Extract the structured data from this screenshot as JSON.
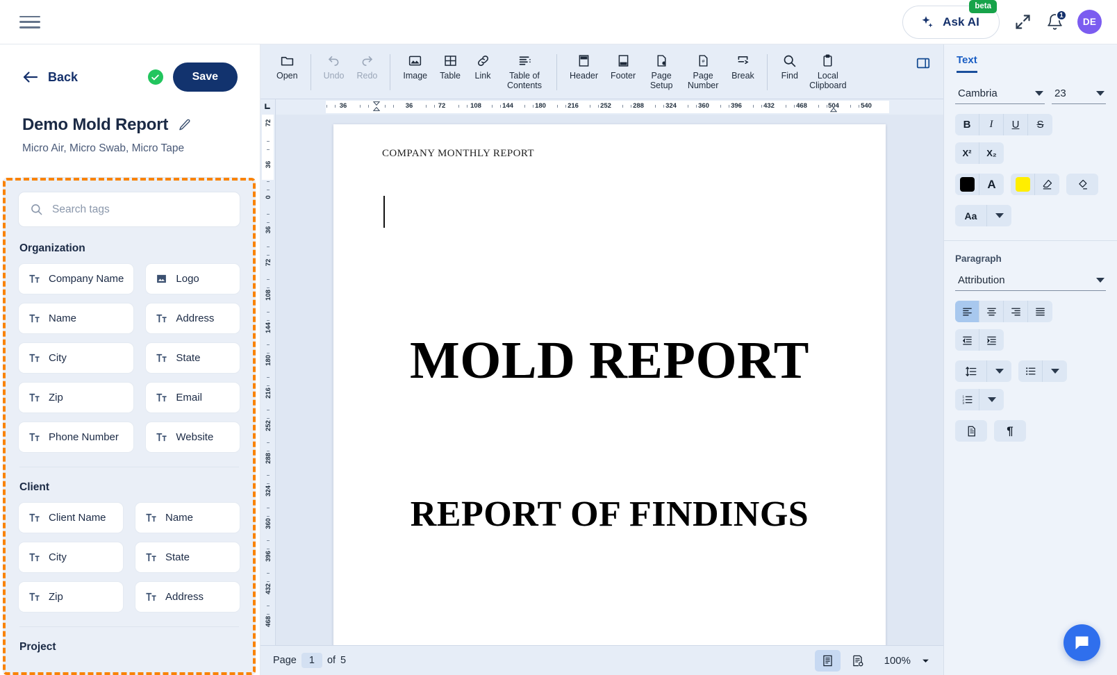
{
  "topbar": {
    "menu_icon": "hamburger-menu-icon",
    "ask_ai": {
      "label": "Ask AI",
      "badge": "beta",
      "icon": "sparkles-icon"
    },
    "fullscreen_icon": "expand-fullscreen-icon",
    "notifications": {
      "icon": "bell-icon",
      "count": "1"
    },
    "avatar": {
      "initials": "DE",
      "color": "#7b5cf0"
    }
  },
  "sidebar": {
    "back_label": "Back",
    "back_icon": "arrow-left-icon",
    "saved_icon": "check-circle-icon",
    "save_label": "Save",
    "document_title": "Demo Mold Report",
    "edit_icon": "pencil-icon",
    "document_subtitle": "Micro Air, Micro Swab, Micro Tape",
    "search": {
      "placeholder": "Search tags",
      "value": "",
      "icon": "search-icon"
    },
    "highlight_color": "#f98307",
    "groups": [
      {
        "title": "Organization",
        "tags": [
          {
            "label": "Company Name",
            "icon": "text-field-icon"
          },
          {
            "label": "Logo",
            "icon": "image-icon"
          },
          {
            "label": "Name",
            "icon": "text-field-icon"
          },
          {
            "label": "Address",
            "icon": "text-field-icon"
          },
          {
            "label": "City",
            "icon": "text-field-icon"
          },
          {
            "label": "State",
            "icon": "text-field-icon"
          },
          {
            "label": "Zip",
            "icon": "text-field-icon"
          },
          {
            "label": "Email",
            "icon": "text-field-icon"
          },
          {
            "label": "Phone Number",
            "icon": "text-field-icon"
          },
          {
            "label": "Website",
            "icon": "text-field-icon"
          }
        ]
      },
      {
        "title": "Client",
        "tags": [
          {
            "label": "Client Name",
            "icon": "text-field-icon"
          },
          {
            "label": "Name",
            "icon": "text-field-icon"
          },
          {
            "label": "City",
            "icon": "text-field-icon"
          },
          {
            "label": "State",
            "icon": "text-field-icon"
          },
          {
            "label": "Zip",
            "icon": "text-field-icon"
          },
          {
            "label": "Address",
            "icon": "text-field-icon"
          }
        ]
      },
      {
        "title": "Project",
        "tags": []
      }
    ]
  },
  "toolbar": {
    "items": [
      {
        "label": "Open",
        "icon": "folder-icon",
        "disabled": false
      },
      {
        "sep": true
      },
      {
        "label": "Undo",
        "icon": "undo-arrow-icon",
        "disabled": true
      },
      {
        "label": "Redo",
        "icon": "redo-arrow-icon",
        "disabled": true
      },
      {
        "sep": true
      },
      {
        "label": "Image",
        "icon": "image-icon",
        "disabled": false
      },
      {
        "label": "Table",
        "icon": "table-grid-icon",
        "disabled": false
      },
      {
        "label": "Link",
        "icon": "link-chain-icon",
        "disabled": false
      },
      {
        "label": "Table of Contents",
        "icon": "table-of-contents-icon",
        "disabled": false
      },
      {
        "sep": true
      },
      {
        "label": "Header",
        "icon": "page-header-icon",
        "disabled": false
      },
      {
        "label": "Footer",
        "icon": "page-footer-icon",
        "disabled": false
      },
      {
        "label": "Page Setup",
        "icon": "page-setup-icon",
        "disabled": false
      },
      {
        "label": "Page Number",
        "icon": "page-number-icon",
        "disabled": false
      },
      {
        "label": "Break",
        "icon": "page-break-icon",
        "disabled": false
      },
      {
        "sep": true
      },
      {
        "label": "Find",
        "icon": "search-icon",
        "disabled": false
      },
      {
        "label": "Local Clipboard",
        "icon": "clipboard-icon",
        "disabled": false
      }
    ],
    "panel_toggle_icon": "right-panel-toggle-icon"
  },
  "ruler": {
    "horizontal_marks": [
      "36",
      "36",
      "72",
      "108",
      "144",
      "180",
      "216",
      "252",
      "288",
      "324",
      "360",
      "396",
      "432",
      "468",
      "504",
      "540"
    ],
    "vertical_marks": [
      "72",
      "36",
      "0",
      "36",
      "72",
      "108",
      "144",
      "180",
      "216",
      "252",
      "288",
      "324",
      "360",
      "396",
      "432",
      "468"
    ],
    "corner_icon": "tab-stop-icon",
    "left_indent_marker": "first-line-indent-marker",
    "right_indent_marker": "right-indent-marker"
  },
  "document": {
    "header_text": "COMPANY MONTHLY REPORT",
    "title": "MOLD REPORT",
    "subtitle": "REPORT OF FINDINGS"
  },
  "statusbar": {
    "page_label": "Page",
    "page_value": "1",
    "of_label": "of",
    "total_pages": "5",
    "view_print_icon": "print-layout-icon",
    "view_draft_icon": "draft-layout-icon",
    "zoom_value": "100%",
    "zoom_caret_icon": "chevron-down-icon"
  },
  "right_panel": {
    "tab_label": "Text",
    "font": {
      "value": "Cambria",
      "caret_icon": "chevron-down-icon"
    },
    "size": {
      "value": "23",
      "caret_icon": "chevron-down-icon"
    },
    "format_buttons": [
      {
        "label": "B",
        "name": "bold-button"
      },
      {
        "label": "I",
        "name": "italic-button"
      },
      {
        "label": "U",
        "name": "underline-button"
      },
      {
        "label": "S",
        "name": "strikethrough-button"
      }
    ],
    "script_buttons": [
      {
        "label": "X²",
        "name": "superscript-button"
      },
      {
        "label": "X₂",
        "name": "subscript-button"
      }
    ],
    "color_controls": {
      "text_color": "#000000",
      "text_color_name": "text-color-swatch",
      "font_color_icon": "font-color-icon",
      "highlight_color": "#ffee00",
      "highlight_icon": "highlighter-icon",
      "clear_format_icon": "clear-formatting-icon"
    },
    "case_button": {
      "label": "Aa",
      "icon": "chevron-down-icon"
    },
    "paragraph": {
      "label": "Paragraph",
      "style": {
        "value": "Attribution",
        "caret_icon": "chevron-down-icon"
      },
      "align_buttons": [
        {
          "name": "align-left-button",
          "active": true
        },
        {
          "name": "align-center-button",
          "active": false
        },
        {
          "name": "align-right-button",
          "active": false
        },
        {
          "name": "align-justify-button",
          "active": false
        }
      ],
      "indent_buttons": [
        {
          "name": "decrease-indent-button"
        },
        {
          "name": "increase-indent-button"
        }
      ],
      "line_spacing_icon": "line-spacing-icon",
      "bullet_list_icon": "bullet-list-icon",
      "numbered_list_icon": "numbered-list-icon",
      "page_settings_icon": "page-properties-icon",
      "pilcrow_icon": "pilcrow-icon"
    }
  },
  "chat_fab": {
    "icon": "chat-bubble-icon",
    "color": "#2f6fed"
  }
}
